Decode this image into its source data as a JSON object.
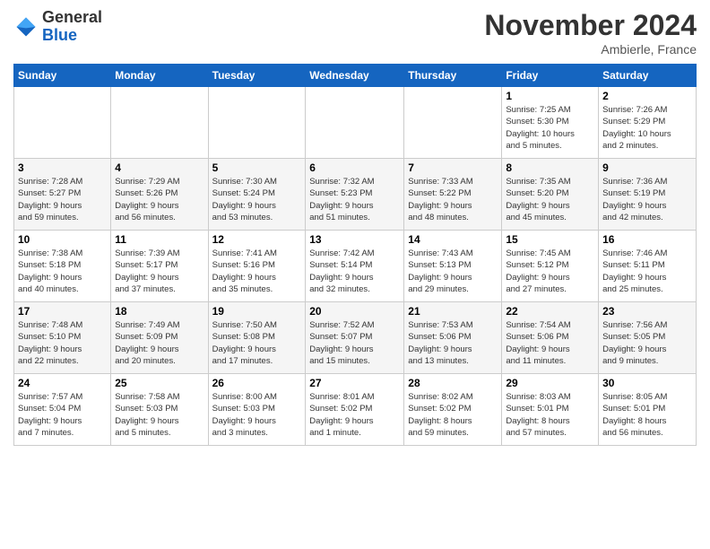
{
  "header": {
    "logo_general": "General",
    "logo_blue": "Blue",
    "month_title": "November 2024",
    "location": "Ambierle, France"
  },
  "weekdays": [
    "Sunday",
    "Monday",
    "Tuesday",
    "Wednesday",
    "Thursday",
    "Friday",
    "Saturday"
  ],
  "weeks": [
    [
      {
        "day": "",
        "info": ""
      },
      {
        "day": "",
        "info": ""
      },
      {
        "day": "",
        "info": ""
      },
      {
        "day": "",
        "info": ""
      },
      {
        "day": "",
        "info": ""
      },
      {
        "day": "1",
        "info": "Sunrise: 7:25 AM\nSunset: 5:30 PM\nDaylight: 10 hours\nand 5 minutes."
      },
      {
        "day": "2",
        "info": "Sunrise: 7:26 AM\nSunset: 5:29 PM\nDaylight: 10 hours\nand 2 minutes."
      }
    ],
    [
      {
        "day": "3",
        "info": "Sunrise: 7:28 AM\nSunset: 5:27 PM\nDaylight: 9 hours\nand 59 minutes."
      },
      {
        "day": "4",
        "info": "Sunrise: 7:29 AM\nSunset: 5:26 PM\nDaylight: 9 hours\nand 56 minutes."
      },
      {
        "day": "5",
        "info": "Sunrise: 7:30 AM\nSunset: 5:24 PM\nDaylight: 9 hours\nand 53 minutes."
      },
      {
        "day": "6",
        "info": "Sunrise: 7:32 AM\nSunset: 5:23 PM\nDaylight: 9 hours\nand 51 minutes."
      },
      {
        "day": "7",
        "info": "Sunrise: 7:33 AM\nSunset: 5:22 PM\nDaylight: 9 hours\nand 48 minutes."
      },
      {
        "day": "8",
        "info": "Sunrise: 7:35 AM\nSunset: 5:20 PM\nDaylight: 9 hours\nand 45 minutes."
      },
      {
        "day": "9",
        "info": "Sunrise: 7:36 AM\nSunset: 5:19 PM\nDaylight: 9 hours\nand 42 minutes."
      }
    ],
    [
      {
        "day": "10",
        "info": "Sunrise: 7:38 AM\nSunset: 5:18 PM\nDaylight: 9 hours\nand 40 minutes."
      },
      {
        "day": "11",
        "info": "Sunrise: 7:39 AM\nSunset: 5:17 PM\nDaylight: 9 hours\nand 37 minutes."
      },
      {
        "day": "12",
        "info": "Sunrise: 7:41 AM\nSunset: 5:16 PM\nDaylight: 9 hours\nand 35 minutes."
      },
      {
        "day": "13",
        "info": "Sunrise: 7:42 AM\nSunset: 5:14 PM\nDaylight: 9 hours\nand 32 minutes."
      },
      {
        "day": "14",
        "info": "Sunrise: 7:43 AM\nSunset: 5:13 PM\nDaylight: 9 hours\nand 29 minutes."
      },
      {
        "day": "15",
        "info": "Sunrise: 7:45 AM\nSunset: 5:12 PM\nDaylight: 9 hours\nand 27 minutes."
      },
      {
        "day": "16",
        "info": "Sunrise: 7:46 AM\nSunset: 5:11 PM\nDaylight: 9 hours\nand 25 minutes."
      }
    ],
    [
      {
        "day": "17",
        "info": "Sunrise: 7:48 AM\nSunset: 5:10 PM\nDaylight: 9 hours\nand 22 minutes."
      },
      {
        "day": "18",
        "info": "Sunrise: 7:49 AM\nSunset: 5:09 PM\nDaylight: 9 hours\nand 20 minutes."
      },
      {
        "day": "19",
        "info": "Sunrise: 7:50 AM\nSunset: 5:08 PM\nDaylight: 9 hours\nand 17 minutes."
      },
      {
        "day": "20",
        "info": "Sunrise: 7:52 AM\nSunset: 5:07 PM\nDaylight: 9 hours\nand 15 minutes."
      },
      {
        "day": "21",
        "info": "Sunrise: 7:53 AM\nSunset: 5:06 PM\nDaylight: 9 hours\nand 13 minutes."
      },
      {
        "day": "22",
        "info": "Sunrise: 7:54 AM\nSunset: 5:06 PM\nDaylight: 9 hours\nand 11 minutes."
      },
      {
        "day": "23",
        "info": "Sunrise: 7:56 AM\nSunset: 5:05 PM\nDaylight: 9 hours\nand 9 minutes."
      }
    ],
    [
      {
        "day": "24",
        "info": "Sunrise: 7:57 AM\nSunset: 5:04 PM\nDaylight: 9 hours\nand 7 minutes."
      },
      {
        "day": "25",
        "info": "Sunrise: 7:58 AM\nSunset: 5:03 PM\nDaylight: 9 hours\nand 5 minutes."
      },
      {
        "day": "26",
        "info": "Sunrise: 8:00 AM\nSunset: 5:03 PM\nDaylight: 9 hours\nand 3 minutes."
      },
      {
        "day": "27",
        "info": "Sunrise: 8:01 AM\nSunset: 5:02 PM\nDaylight: 9 hours\nand 1 minute."
      },
      {
        "day": "28",
        "info": "Sunrise: 8:02 AM\nSunset: 5:02 PM\nDaylight: 8 hours\nand 59 minutes."
      },
      {
        "day": "29",
        "info": "Sunrise: 8:03 AM\nSunset: 5:01 PM\nDaylight: 8 hours\nand 57 minutes."
      },
      {
        "day": "30",
        "info": "Sunrise: 8:05 AM\nSunset: 5:01 PM\nDaylight: 8 hours\nand 56 minutes."
      }
    ]
  ]
}
